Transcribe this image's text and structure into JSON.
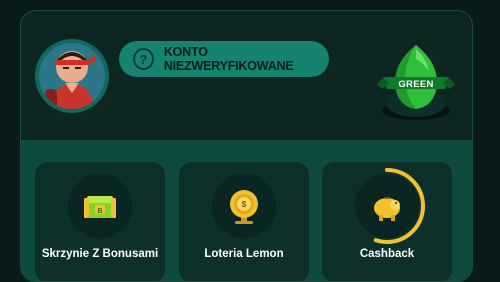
{
  "profile": {
    "status_text": "KONTO NIEZWERYFIKOWANE",
    "help_symbol": "?",
    "rank_label": "GREEN"
  },
  "cards": [
    {
      "label": "Skrzynie Z Bonusami",
      "icon": "treasure-chest-icon"
    },
    {
      "label": "Loteria Lemon",
      "icon": "prize-wheel-icon"
    },
    {
      "label": "Cashback",
      "icon": "piggy-bank-icon"
    }
  ],
  "colors": {
    "background": "#0a1c1a",
    "panel": "#0d2622",
    "accent": "#15836f",
    "card": "#0d302b",
    "gold": "#f2c12e",
    "green_gem": "#2fbf3a"
  },
  "cashback_progress": 0.55
}
